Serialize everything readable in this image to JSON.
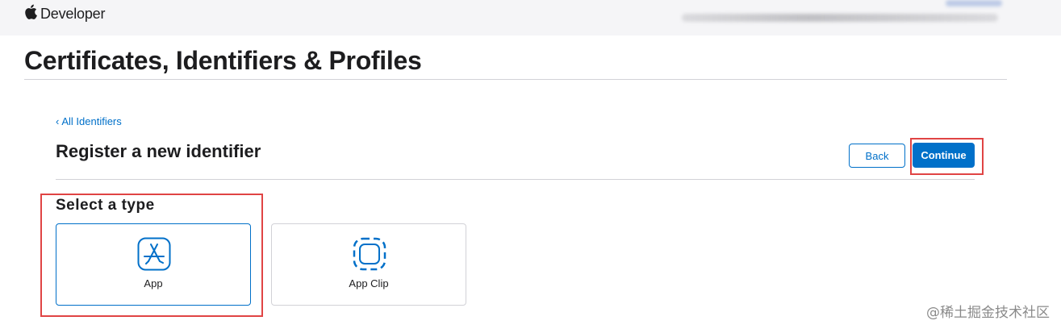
{
  "header": {
    "brand": "Developer",
    "brand_icon": "apple-logo-icon"
  },
  "page": {
    "title": "Certificates, Identifiers & Profiles"
  },
  "breadcrumb": {
    "chevron": "‹",
    "label": "All Identifiers"
  },
  "section": {
    "title": "Register a new identifier",
    "back_label": "Back",
    "continue_label": "Continue"
  },
  "type_selector": {
    "label": "Select a type",
    "options": [
      {
        "label": "App",
        "icon": "app-store-icon",
        "selected": true
      },
      {
        "label": "App Clip",
        "icon": "app-clip-icon",
        "selected": false
      }
    ]
  },
  "colors": {
    "accent": "#0070c9",
    "annotation": "#e04444",
    "topbar": "#f5f5f7"
  },
  "watermark": "@稀土掘金技术社区"
}
